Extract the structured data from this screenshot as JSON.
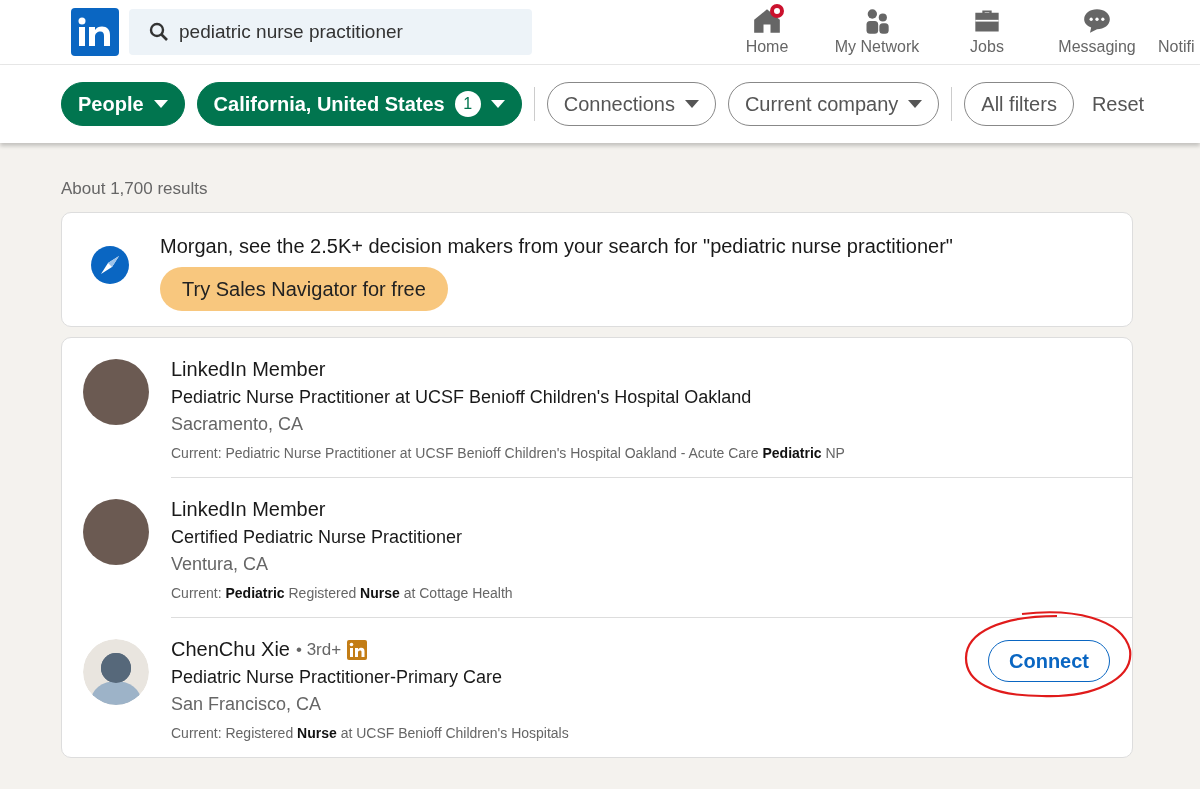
{
  "header": {
    "search": {
      "value": "pediatric nurse practitioner"
    },
    "nav": [
      {
        "label": "Home",
        "kind": "home",
        "badge": true
      },
      {
        "label": "My Network",
        "kind": "network",
        "badge": false
      },
      {
        "label": "Jobs",
        "kind": "jobs",
        "badge": false
      },
      {
        "label": "Messaging",
        "kind": "messaging",
        "badge": false
      },
      {
        "label": "Notifi",
        "kind": "cut",
        "badge": false
      }
    ]
  },
  "filters": [
    {
      "label": "People",
      "selected": true,
      "dropdown": true
    },
    {
      "label": "California, United States",
      "selected": true,
      "dropdown": true,
      "count": "1"
    },
    {
      "label": "Connections",
      "selected": false,
      "dropdown": true
    },
    {
      "label": "Current company",
      "selected": false,
      "dropdown": true
    },
    {
      "label": "All filters",
      "selected": false,
      "dropdown": false
    }
  ],
  "reset": "Reset",
  "results_count": "About 1,700 results",
  "promo": {
    "text": "Morgan, see the 2.5K+ decision makers from your search for \"pediatric nurse practitioner\"",
    "button": "Try Sales Navigator for free"
  },
  "results": [
    {
      "name": "LinkedIn Member",
      "kind": "photo",
      "headline": "Pediatric Nurse Practitioner at UCSF Benioff Children's Hospital Oakland",
      "location": "Sacramento, CA",
      "snippet": "Current: Pediatric Nurse Practitioner at UCSF Benioff Children's Hospital Oakland - Acute Care **Pediatric** NP"
    },
    {
      "name": "LinkedIn Member",
      "kind": "photo",
      "headline": "Certified Pediatric Nurse Practitioner",
      "location": "Ventura, CA",
      "snippet": "Current: **Pediatric** Registered **Nurse** at Cottage Health"
    },
    {
      "name": "ChenChu Xie",
      "kind": "silhouette",
      "degree": "• 3rd+",
      "premium": true,
      "headline": "Pediatric Nurse Practitioner-Primary Care",
      "location": "San Francisco, CA",
      "snippet": "Current: Registered **Nurse** at UCSF Benioff Children's Hospitals",
      "action": "Connect",
      "circled": true
    }
  ]
}
